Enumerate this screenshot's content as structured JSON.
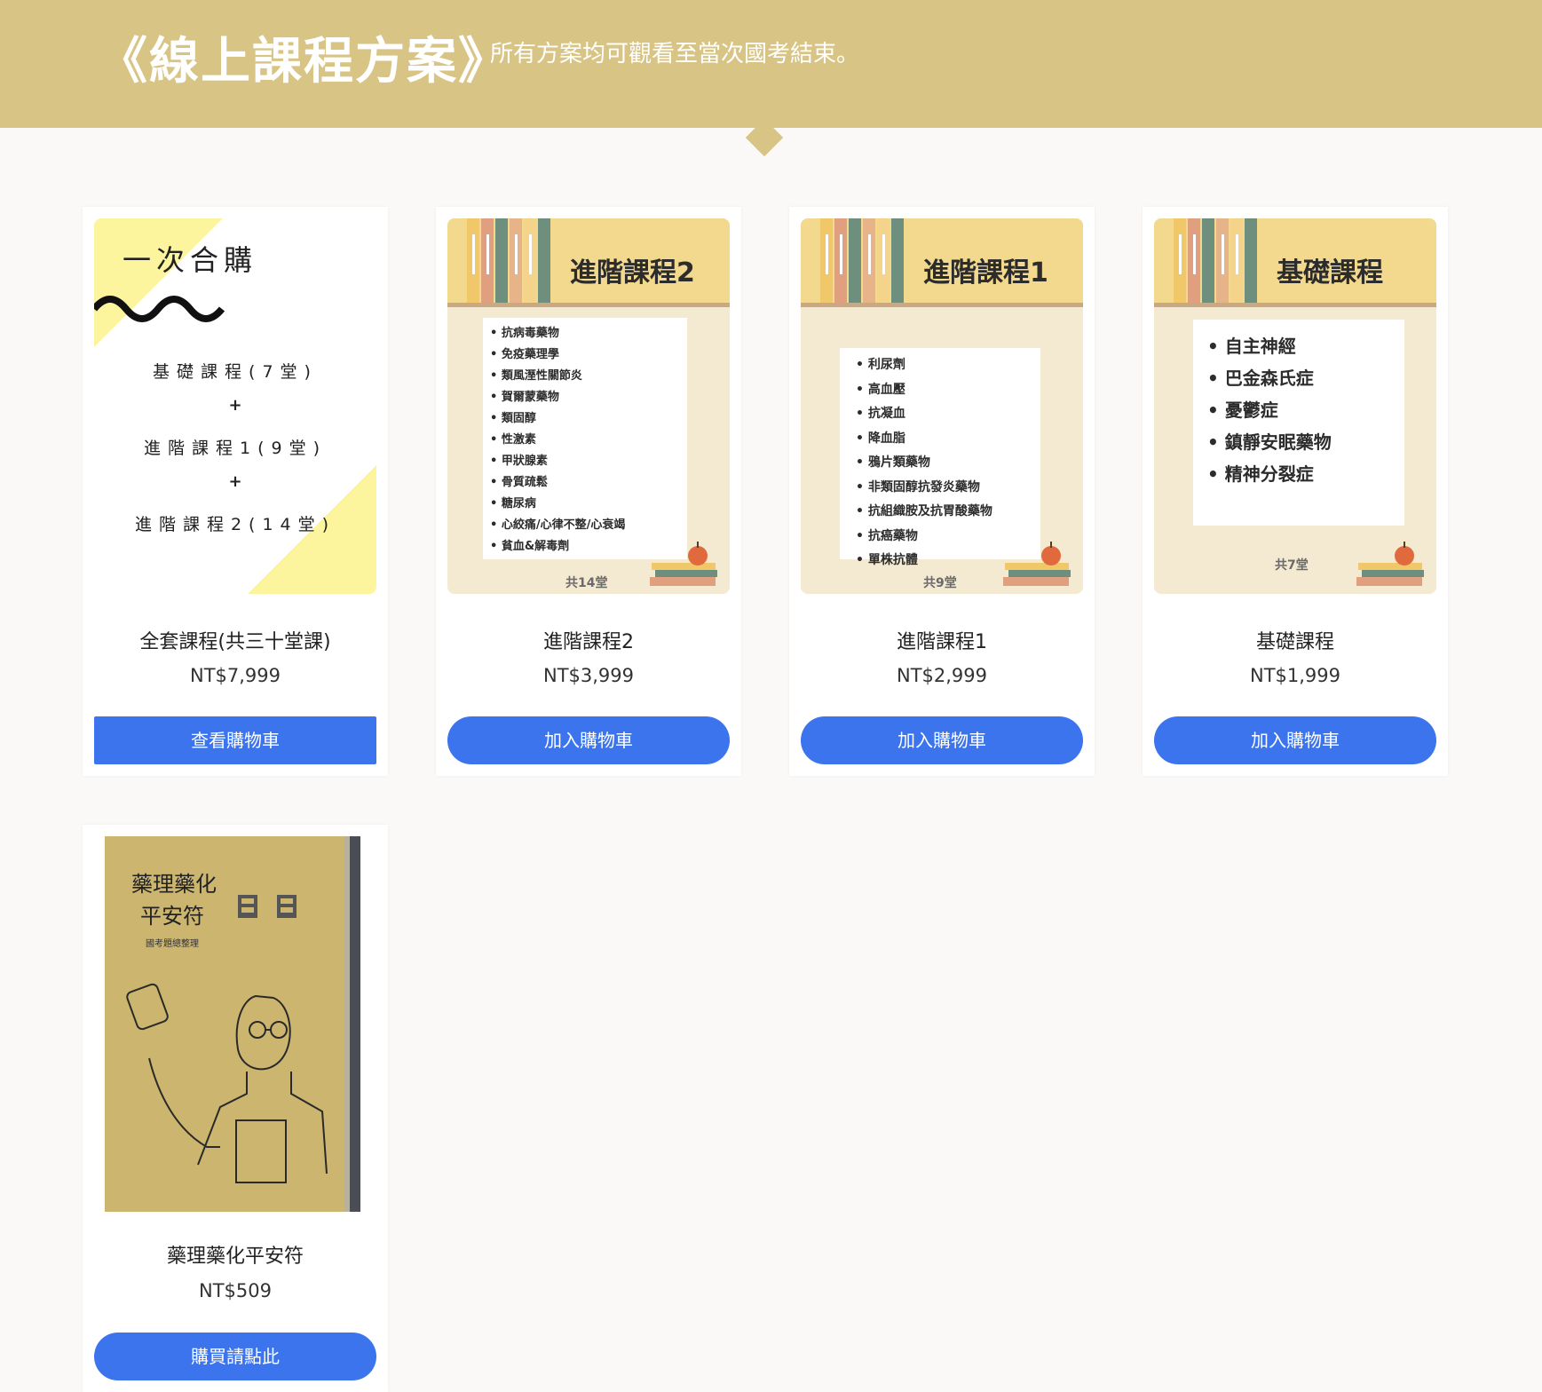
{
  "header": {
    "title": "《線上課程方案》",
    "subtitle": "所有方案均可觀看至當次國考結束。"
  },
  "products": [
    {
      "name": "全套課程(共三十堂課)",
      "price": "NT$7,999",
      "button": "查看購物車",
      "image": {
        "heading": "一次合購",
        "lines": [
          "基礎課程(7堂)",
          "+",
          "進階課程1(9堂)",
          "+",
          "進階課程2(14堂)"
        ]
      }
    },
    {
      "name": "進階課程2",
      "price": "NT$3,999",
      "button": "加入購物車",
      "image": {
        "title": "進階課程2",
        "items": [
          "抗病毒藥物",
          "免疫藥理學",
          "類風溼性關節炎",
          "賀爾蒙藥物",
          "類固醇",
          "性激素",
          "甲狀腺素",
          "骨質疏鬆",
          "糖尿病",
          "心絞痛/心律不整/心衰竭",
          "貧血&解毒劑"
        ],
        "count": "共14堂"
      }
    },
    {
      "name": "進階課程1",
      "price": "NT$2,999",
      "button": "加入購物車",
      "image": {
        "title": "進階課程1",
        "items": [
          "利尿劑",
          "高血壓",
          "抗凝血",
          "降血脂",
          "鴉片類藥物",
          "非類固醇抗發炎藥物",
          "抗組織胺及抗胃酸藥物",
          "抗癌藥物",
          "單株抗體"
        ],
        "count": "共9堂"
      }
    },
    {
      "name": "基礎課程",
      "price": "NT$1,999",
      "button": "加入購物車",
      "image": {
        "title": "基礎課程",
        "items": [
          "自主神經",
          "巴金森氏症",
          "憂鬱症",
          "鎮靜安眠藥物",
          "精神分裂症"
        ],
        "count": "共7堂"
      }
    },
    {
      "name": "藥理藥化平安符",
      "price": "NT$509",
      "button": "購買請點此",
      "image": {
        "title_line1": "藥理藥化",
        "title_line2": "平安符",
        "small": "國考題總整理"
      }
    }
  ],
  "colors": {
    "banner": "#d8c586",
    "button": "#3c74ee",
    "poster_band": "#f2d98d",
    "poster_bg": "#f4ead2",
    "book_cover": "#ccb56e"
  }
}
